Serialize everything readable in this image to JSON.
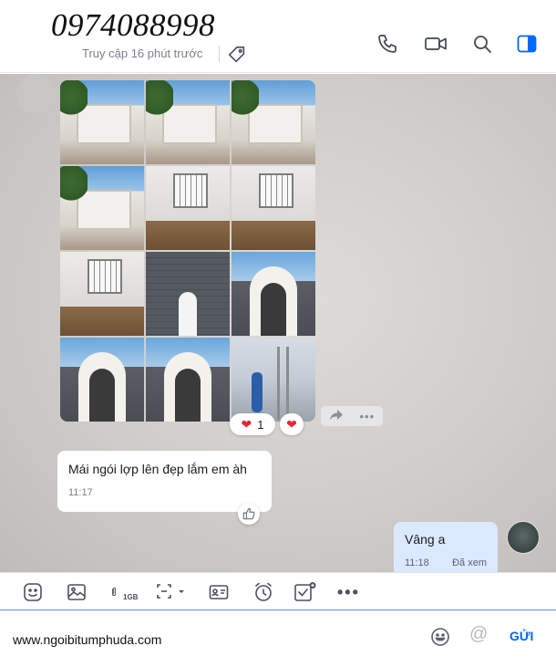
{
  "header": {
    "contact_name": "0974088998",
    "status": "Truy cập 16 phút trước"
  },
  "messages": {
    "photo_reaction_count": "1",
    "received_text": "Mái ngói lợp lên đẹp lắm em àh",
    "received_time": "11:17",
    "sent_text": "Vâng a",
    "sent_time": "11:18",
    "sent_status": "Đã xem"
  },
  "toolbar": {
    "file_size_label": "1GB"
  },
  "composer": {
    "input_value": "www.ngoibitumphuda.com",
    "send_label": "GỬI"
  },
  "icons": {
    "header": [
      "phone-icon",
      "video-call-icon",
      "search-icon",
      "sidebar-toggle-icon"
    ],
    "toolbar": [
      "sticker-icon",
      "image-icon",
      "attachment-icon",
      "screenshot-icon",
      "contact-card-icon",
      "reminder-icon",
      "task-icon",
      "more-icon"
    ]
  },
  "colors": {
    "accent": "#0068ff",
    "sent_bubble": "#dbe9ff",
    "heart": "#e5253a"
  }
}
